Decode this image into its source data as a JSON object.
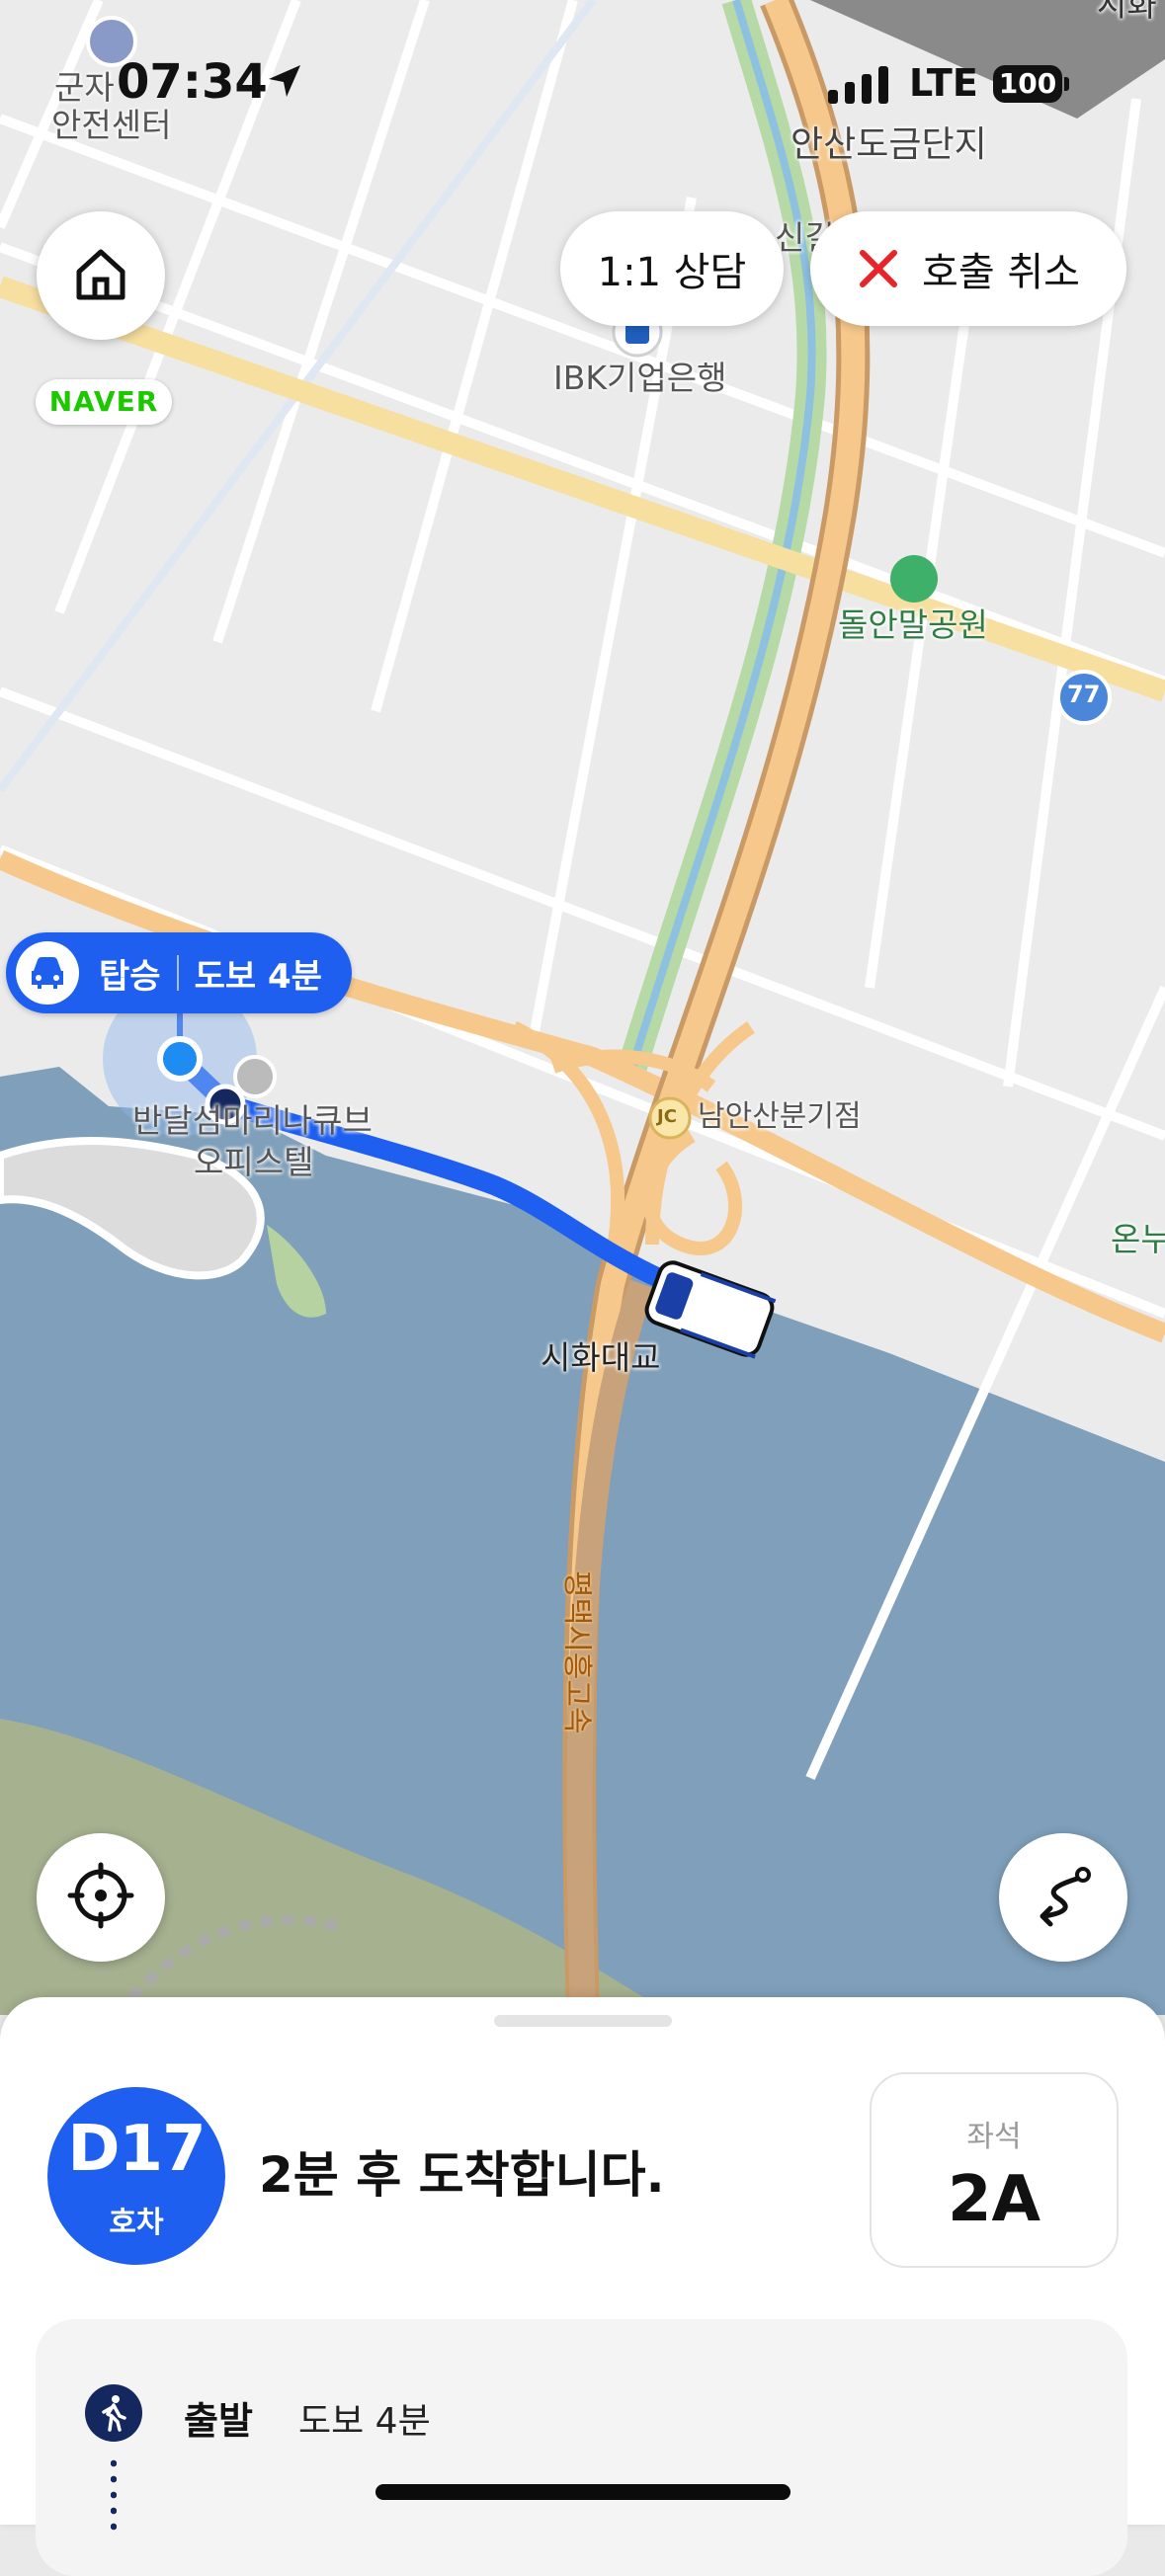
{
  "status_bar": {
    "time": "07:34",
    "location_icon": "location-arrow-icon",
    "network": "LTE",
    "battery": "100"
  },
  "top_buttons": {
    "home_icon": "home-icon",
    "consult_label": "1:1 상담",
    "cancel_icon": "close-x-icon",
    "cancel_label": "호출 취소",
    "naver_logo": "NAVER"
  },
  "map": {
    "labels": {
      "safety_center_1": "군자",
      "safety_center_2": "안전센터",
      "complex": "안산도금단지",
      "sinkil": "신길",
      "bank": "IBK기업은행",
      "park": "돌안말공원",
      "route_no": "77",
      "junction_badge": "JC",
      "junction": "남안산분기점",
      "building_1": "반달섬마리나큐브",
      "building_2": "오피스텔",
      "bridge": "시화대교",
      "expressway": "평택시흥고속",
      "top_right": "시화",
      "right_edge": "온누"
    },
    "boarding_badge": {
      "icon": "car-icon",
      "label": "탑승",
      "walk": "도보 4분"
    },
    "controls": {
      "locate_icon": "crosshair-icon",
      "route_icon": "route-icon"
    },
    "colors": {
      "water": "#7f9fba",
      "road": "#f6c88b",
      "route": "#1e5ff0",
      "land": "#e9e9e9"
    }
  },
  "sheet": {
    "car_number": "D17",
    "car_unit": "호차",
    "arrival_text": "2분 후 도착합니다.",
    "seat_label": "좌석",
    "seat_value": "2A",
    "route": {
      "departure_label": "출발",
      "departure_walk": "도보 4분",
      "walk_icon": "walking-person-icon"
    }
  }
}
